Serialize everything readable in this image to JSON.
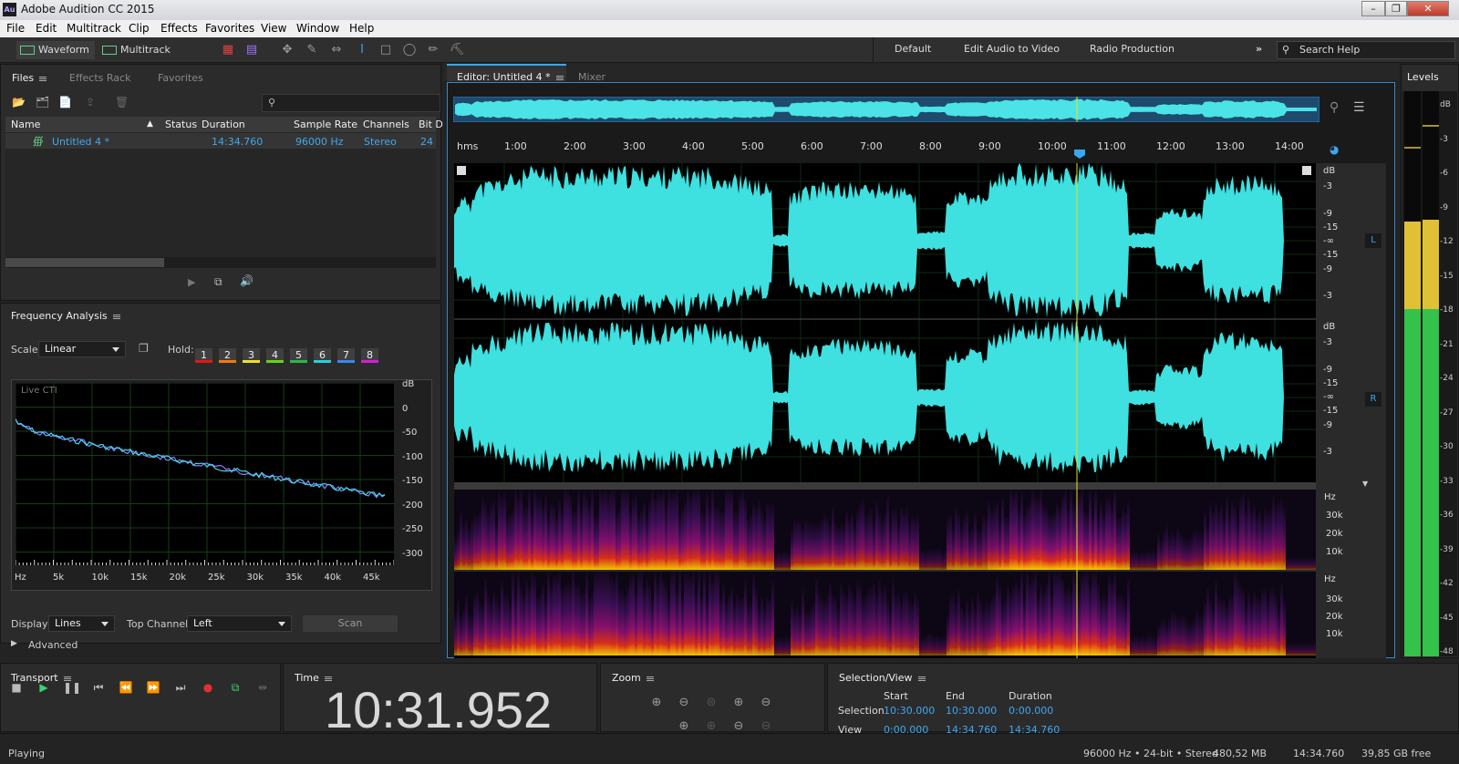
{
  "window": {
    "title": "Adobe Audition CC 2015",
    "app_icon": "Au"
  },
  "menu": [
    "File",
    "Edit",
    "Multitrack",
    "Clip",
    "Effects",
    "Favorites",
    "View",
    "Window",
    "Help"
  ],
  "modes": {
    "waveform": "Waveform",
    "multitrack": "Multitrack"
  },
  "workspaces": [
    "Default",
    "Edit Audio to Video",
    "Radio Production"
  ],
  "search": {
    "placeholder": "Search Help"
  },
  "files_panel": {
    "tabs": [
      "Files",
      "Effects Rack",
      "Favorites"
    ],
    "columns": [
      "Name",
      "Status",
      "Duration",
      "Sample Rate",
      "Channels",
      "Bit D"
    ],
    "rows": [
      {
        "name": "Untitled 4 *",
        "status": "",
        "duration": "14:34.760",
        "sample_rate": "96000 Hz",
        "channels": "Stereo",
        "bit_depth": "24"
      }
    ]
  },
  "freq": {
    "title": "Frequency Analysis",
    "scale_label": "Scale:",
    "scale_value": "Linear",
    "hold_label": "Hold:",
    "holds": [
      {
        "n": "1",
        "color": "#e01818"
      },
      {
        "n": "2",
        "color": "#f07a10"
      },
      {
        "n": "3",
        "color": "#f0e020"
      },
      {
        "n": "4",
        "color": "#6ad01a"
      },
      {
        "n": "5",
        "color": "#2cb84a"
      },
      {
        "n": "6",
        "color": "#28d0d8"
      },
      {
        "n": "7",
        "color": "#3a86f0"
      },
      {
        "n": "8",
        "color": "#d020d0"
      }
    ],
    "graph_label": "Live CTI",
    "db_ticks": [
      "dB",
      "0",
      "-50",
      "-100",
      "-150",
      "-200",
      "-250",
      "-300"
    ],
    "hz_ticks": [
      "Hz",
      "5k",
      "10k",
      "15k",
      "20k",
      "25k",
      "30k",
      "35k",
      "40k",
      "45k"
    ],
    "display_label": "Display:",
    "display_value": "Lines",
    "top_channel_label": "Top Channel:",
    "top_channel_value": "Left",
    "scan_label": "Scan",
    "advanced_label": "Advanced"
  },
  "editor": {
    "tab": "Editor: Untitled 4 *",
    "mixer": "Mixer",
    "ruler_unit": "hms",
    "ruler": [
      "1:00",
      "2:00",
      "3:00",
      "4:00",
      "5:00",
      "6:00",
      "7:00",
      "8:00",
      "9:00",
      "10:00",
      "11:00",
      "12:00",
      "13:00",
      "14:00"
    ],
    "db_scale": [
      "dB",
      "-3",
      "-9",
      "-15",
      "-∞",
      "-15",
      "-9",
      "-3"
    ],
    "left_channel": "L",
    "right_channel": "R",
    "hz_unit": "Hz",
    "hz_scale": [
      "30k",
      "20k",
      "10k"
    ],
    "waveform_color": "#3ee0e0"
  },
  "levels": {
    "title": "Levels",
    "scale": [
      "dB",
      "-3",
      "-6",
      "-9",
      "-12",
      "-15",
      "-18",
      "-21",
      "-24",
      "-27",
      "-30",
      "-33",
      "-36",
      "-39",
      "-42",
      "-45",
      "-48"
    ]
  },
  "transport": {
    "title": "Transport"
  },
  "time": {
    "title": "Time",
    "value": "10:31.952"
  },
  "zoom": {
    "title": "Zoom"
  },
  "selection": {
    "title": "Selection/View",
    "cols": [
      "Start",
      "End",
      "Duration"
    ],
    "selection_label": "Selection",
    "view_label": "View",
    "selection": [
      "10:30.000",
      "10:30.000",
      "0:00.000"
    ],
    "view": [
      "0:00.000",
      "14:34.760",
      "14:34.760"
    ]
  },
  "status": {
    "state": "Playing",
    "format": "96000 Hz • 24-bit • Stereo",
    "size": "480,52 MB",
    "duration": "14:34.760",
    "free": "39,85 GB free"
  }
}
